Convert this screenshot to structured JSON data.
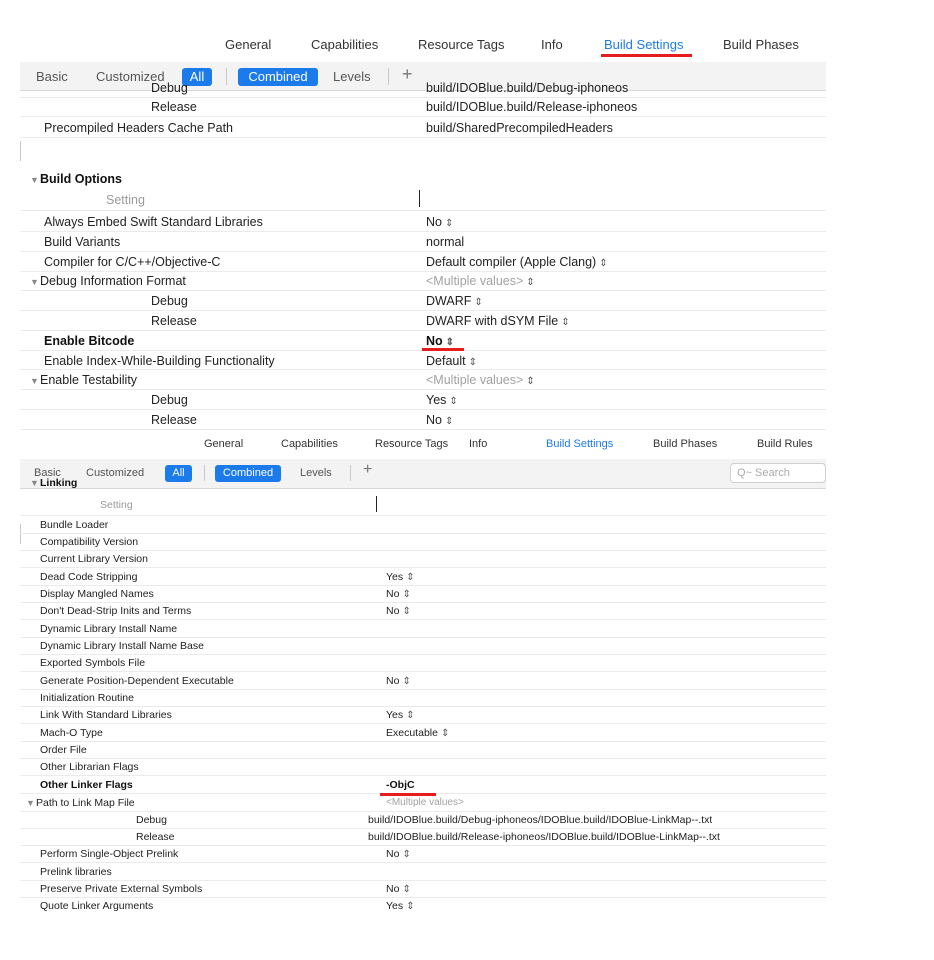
{
  "top_panel": {
    "tabs": [
      "General",
      "Capabilities",
      "Resource Tags",
      "Info",
      "Build Settings",
      "Build Phases"
    ],
    "active_tab": "Build Settings",
    "filters": {
      "basic": "Basic",
      "customized": "Customized",
      "all": "All",
      "combined": "Combined",
      "levels": "Levels",
      "add": "+"
    },
    "clipped_row": {
      "key": "Debug",
      "value": "build/IDOBlue.build/Debug-iphoneos"
    },
    "rows_before": [
      {
        "key": "Release",
        "value": "build/IDOBlue.build/Release-iphoneos"
      },
      {
        "key": "Precompiled Headers Cache Path",
        "value": "build/SharedPrecompiledHeaders"
      }
    ],
    "section_title": "Build Options",
    "setting_header": "Setting",
    "rows": [
      {
        "key": "Always Embed Swift Standard Libraries",
        "value": "No"
      },
      {
        "key": "Build Variants",
        "value": "normal"
      },
      {
        "key": "Compiler for C/C++/Objective-C",
        "value": "Default compiler (Apple Clang)"
      },
      {
        "key": "Debug Information Format",
        "value": "<Multiple values>"
      },
      {
        "key": "Debug",
        "value": "DWARF"
      },
      {
        "key": "Release",
        "value": "DWARF with dSYM File"
      },
      {
        "key": "Enable Bitcode",
        "value": "No"
      },
      {
        "key": "Enable Index-While-Building Functionality",
        "value": "Default"
      },
      {
        "key": "Enable Testability",
        "value": "<Multiple values>"
      },
      {
        "key": "Debug",
        "value": "Yes"
      },
      {
        "key": "Release",
        "value": "No"
      }
    ]
  },
  "bottom_panel": {
    "tabs": [
      "General",
      "Capabilities",
      "Resource Tags",
      "Info",
      "Build Settings",
      "Build Phases",
      "Build Rules"
    ],
    "active_tab": "Build Settings",
    "filters": {
      "basic": "Basic",
      "customized": "Customized",
      "all": "All",
      "combined": "Combined",
      "levels": "Levels",
      "add": "+"
    },
    "search_placeholder": "Q~ Search",
    "clipped_section": "Linking",
    "setting_header": "Setting",
    "rows": [
      {
        "key": "Bundle Loader",
        "value": ""
      },
      {
        "key": "Compatibility Version",
        "value": ""
      },
      {
        "key": "Current Library Version",
        "value": ""
      },
      {
        "key": "Dead Code Stripping",
        "value": "Yes"
      },
      {
        "key": "Display Mangled Names",
        "value": "No"
      },
      {
        "key": "Don't Dead-Strip Inits and Terms",
        "value": "No"
      },
      {
        "key": "Dynamic Library Install Name",
        "value": ""
      },
      {
        "key": "Dynamic Library Install Name Base",
        "value": ""
      },
      {
        "key": "Exported Symbols File",
        "value": ""
      },
      {
        "key": "Generate Position-Dependent Executable",
        "value": "No"
      },
      {
        "key": "Initialization Routine",
        "value": ""
      },
      {
        "key": "Link With Standard Libraries",
        "value": "Yes"
      },
      {
        "key": "Mach-O Type",
        "value": "Executable"
      },
      {
        "key": "Order File",
        "value": ""
      },
      {
        "key": "Other Librarian Flags",
        "value": ""
      },
      {
        "key": "Other Linker Flags",
        "value": "-ObjC"
      },
      {
        "key": "Path to Link Map File",
        "value": "<Multiple values>"
      },
      {
        "key": "Debug",
        "value": "build/IDOBlue.build/Debug-iphoneos/IDOBlue.build/IDOBlue-LinkMap--.txt"
      },
      {
        "key": "Release",
        "value": "build/IDOBlue.build/Release-iphoneos/IDOBlue.build/IDOBlue-LinkMap--.txt"
      },
      {
        "key": "Perform Single-Object Prelink",
        "value": "No"
      },
      {
        "key": "Prelink libraries",
        "value": ""
      },
      {
        "key": "Preserve Private External Symbols",
        "value": "No"
      },
      {
        "key": "Quote Linker Arguments",
        "value": "Yes"
      }
    ]
  },
  "colors": {
    "accent": "#1c7bea",
    "highlight": "#e51d1d"
  }
}
